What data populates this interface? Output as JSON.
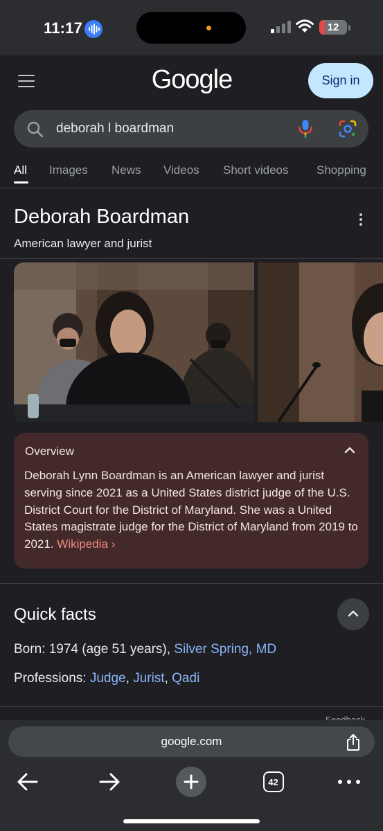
{
  "status_bar": {
    "time": "11:17",
    "battery_level": "12",
    "colors": {
      "battery_low": "#e5484d",
      "siri_badge": "#3b7df5",
      "camera_dot": "#f39a1e"
    }
  },
  "header": {
    "logo": "Google",
    "sign_in_label": "Sign in",
    "icons": {
      "menu": "hamburger-menu-icon"
    }
  },
  "search": {
    "query": "deborah l boardman",
    "icons": {
      "search": "search-icon",
      "voice": "microphone-icon",
      "lens": "google-lens-icon"
    }
  },
  "tabs": [
    {
      "label": "All",
      "active": true
    },
    {
      "label": "Images",
      "active": false
    },
    {
      "label": "News",
      "active": false
    },
    {
      "label": "Videos",
      "active": false
    },
    {
      "label": "Short videos",
      "active": false
    },
    {
      "label": "Shopping",
      "active": false
    }
  ],
  "knowledge_panel": {
    "title": "Deborah Boardman",
    "subtitle": "American lawyer and jurist",
    "overview": {
      "heading": "Overview",
      "text": "Deborah Lynn Boardman is an American lawyer and jurist serving since 2021 as a United States district judge of the U.S. District Court for the District of Maryland. She was a United States magistrate judge for the District of Maryland from 2019 to 2021.",
      "source_link": "Wikipedia",
      "source_arrow": "›",
      "colors": {
        "background": "#44292a",
        "link": "#f28b82"
      }
    },
    "quick_facts": {
      "title": "Quick facts",
      "born": {
        "label": "Born",
        "value": "1974 (age 51 years),",
        "place": "Silver Spring, MD"
      },
      "professions": {
        "label": "Professions",
        "items": [
          "Judge",
          "Jurist",
          "Qadi"
        ]
      }
    },
    "feedback_label": "Feedback"
  },
  "browser": {
    "url": "google.com",
    "tab_count": "42",
    "icons": {
      "back": "back-arrow-icon",
      "forward": "forward-arrow-icon",
      "new_tab": "plus-icon",
      "tabs": "tabs-icon",
      "more": "more-icon",
      "share": "share-icon"
    }
  }
}
